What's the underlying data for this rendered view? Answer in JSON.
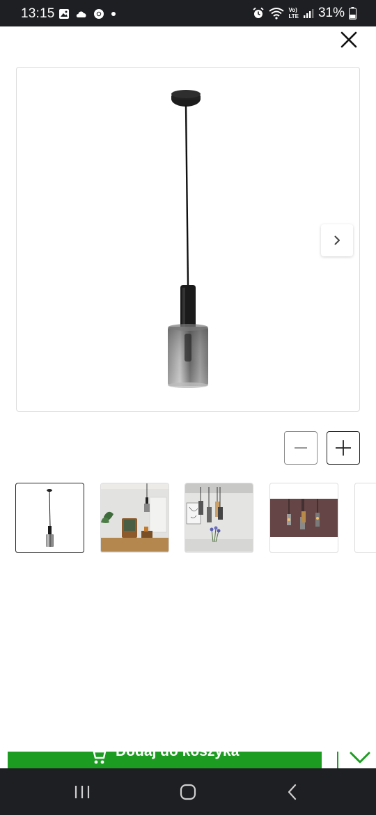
{
  "status_bar": {
    "time": "13:15",
    "battery": "31%",
    "left_icons": [
      "image-icon",
      "cloud-icon",
      "chrome-icon",
      "dot-icon"
    ],
    "right_icons": [
      "alarm-icon",
      "wifi-icon",
      "volte-icon",
      "signal-icon",
      "battery-icon"
    ],
    "volte_label_top": "Vo)",
    "volte_label_bottom": "LTE"
  },
  "gallery": {
    "main_image": "pendant-lamp-smoked-glass",
    "next_button": "chevron-right-icon",
    "zoom_out_icon": "minus-icon",
    "zoom_in_icon": "plus-icon",
    "thumbnails": [
      {
        "name": "thumb-product",
        "active": true
      },
      {
        "name": "thumb-living-room",
        "active": false
      },
      {
        "name": "thumb-three-lamps-dining",
        "active": false
      },
      {
        "name": "thumb-three-lamps-dark",
        "active": false
      },
      {
        "name": "thumb-partial",
        "active": false
      }
    ]
  },
  "cart": {
    "label": "Dodaj do koszyka",
    "color": "#1d9c22"
  },
  "colors": {
    "accent_green": "#1d9c22",
    "system_bar": "#1e1f22"
  }
}
